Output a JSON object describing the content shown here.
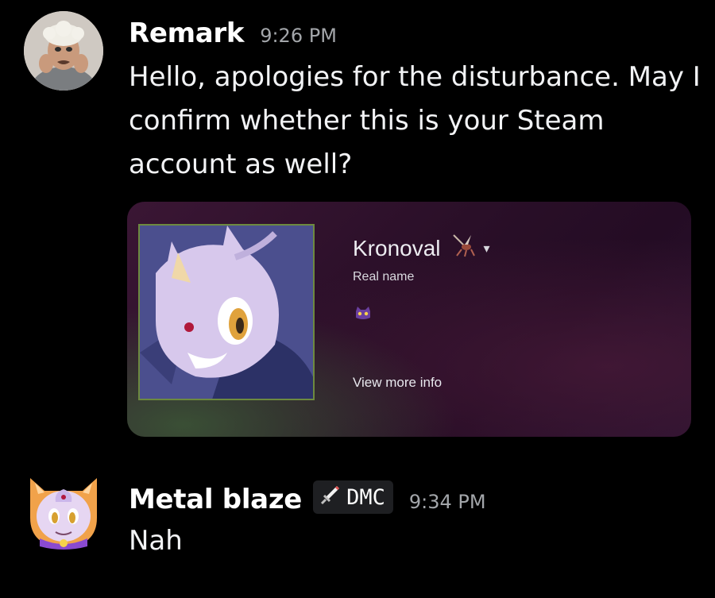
{
  "messages": [
    {
      "username": "Remark",
      "timestamp": "9:26 PM",
      "text": "Hello, apologies for the disturbance. May I confirm whether this is your Steam account as well?",
      "embed": {
        "profile_name": "Kronoval",
        "real_name_label": "Real name",
        "view_more_label": "View more info",
        "avatar_icon": "cat-character-avatar-icon",
        "badge_icon": "cat-badge-icon"
      }
    },
    {
      "username": "Metal blaze",
      "tag": "DMC",
      "tag_icon": "sword-icon",
      "timestamp": "9:34 PM",
      "text": "Nah"
    }
  ],
  "colors": {
    "background": "#000000",
    "username": "#ffffff",
    "timestamp": "#a3a6aa",
    "message_text": "#f2f3f5",
    "tag_background": "#1e1f22"
  }
}
